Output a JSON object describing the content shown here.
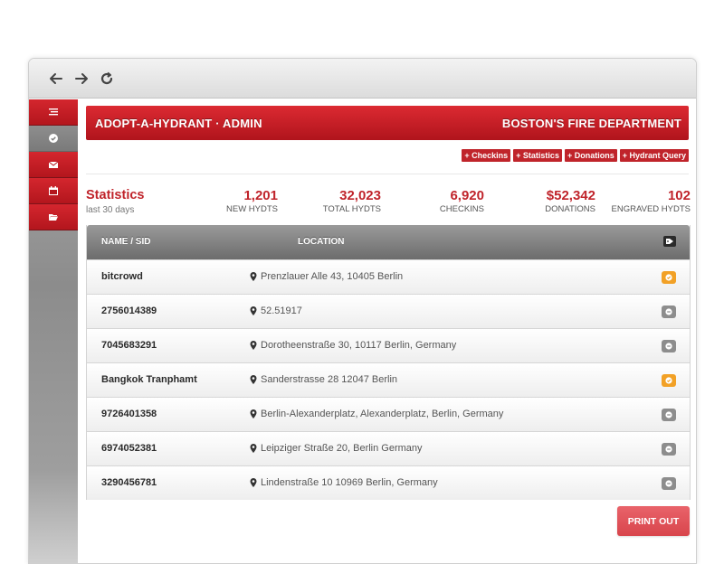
{
  "toolbar": {
    "back_icon": "arrow-left-icon",
    "forward_icon": "arrow-right-icon",
    "reload_icon": "reload-icon"
  },
  "sidebar": {
    "items": [
      {
        "icon": "list-icon",
        "active": true
      },
      {
        "icon": "check-circle-icon",
        "active": false
      },
      {
        "icon": "envelope-icon",
        "active": true
      },
      {
        "icon": "calendar-icon",
        "active": true
      },
      {
        "icon": "folder-open-icon",
        "active": true
      }
    ]
  },
  "header": {
    "title": "ADOPT-A-HYDRANT · ADMIN",
    "org": "BOSTON'S FIRE DEPARTMENT"
  },
  "quick_links": [
    "+ Checkins",
    "+ Statistics",
    "+ Donations",
    "+ Hydrant Query"
  ],
  "stats": {
    "title": "Statistics",
    "subtitle": "last 30 days",
    "items": [
      {
        "value": "1,201",
        "label": "NEW HYDTS"
      },
      {
        "value": "32,023",
        "label": "TOTAL HYDTS"
      },
      {
        "value": "6,920",
        "label": "CHECKINS"
      },
      {
        "value": "$52,342",
        "label": "DONATIONS"
      },
      {
        "value": "102",
        "label": "ENGRAVED HYDTS"
      }
    ]
  },
  "table": {
    "headers": {
      "name": "NAME / SID",
      "location": "LOCATION"
    },
    "rows": [
      {
        "name": "bitcrowd",
        "location": "Prenzlauer Alle 43, 10405 Berlin",
        "status": "checked"
      },
      {
        "name": "2756014389",
        "location": "52.51917",
        "status": "minus"
      },
      {
        "name": "7045683291",
        "location": "Dorotheenstraße 30, 10117 Berlin, Germany",
        "status": "minus"
      },
      {
        "name": "Bangkok Tranphamt",
        "location": "Sanderstrasse 28 12047 Berlin",
        "status": "checked"
      },
      {
        "name": "9726401358",
        "location": "Berlin-Alexanderplatz, Alexanderplatz, Berlin, Germany",
        "status": "minus"
      },
      {
        "name": "6974052381",
        "location": "Leipziger Straße 20, Berlin Germany",
        "status": "minus"
      },
      {
        "name": "3290456781",
        "location": "Lindenstraße 10 10969 Berlin, Germany",
        "status": "minus"
      }
    ]
  },
  "actions": {
    "print_label": "PRINT OUT"
  },
  "colors": {
    "brand_red": "#c0242b",
    "status_orange": "#f2a126",
    "status_grey": "#8d8d8d"
  }
}
